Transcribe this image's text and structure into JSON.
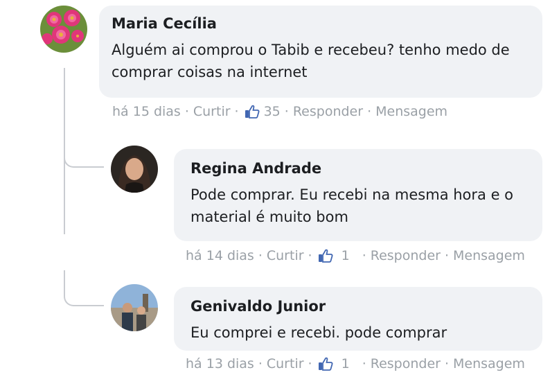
{
  "comments": [
    {
      "author": "Maria Cecília",
      "text": "Alguém ai comprou o Tabib e recebeu? tenho medo de comprar coisas na internet",
      "time": "há 15 dias",
      "like_label": "Curtir",
      "likes": "35",
      "reply_label": "Responder",
      "message_label": "Mensagem"
    },
    {
      "author": "Regina Andrade",
      "text": "Pode comprar. Eu recebi na mesma hora e o material é muito bom",
      "time": "há 14 dias",
      "like_label": "Curtir",
      "likes": "1",
      "reply_label": "Responder",
      "message_label": "Mensagem"
    },
    {
      "author": "Genivaldo Junior",
      "text": "Eu comprei e recebi. pode comprar",
      "time": "há 13 dias",
      "like_label": "Curtir",
      "likes": "1",
      "reply_label": "Responder",
      "message_label": "Mensagem"
    }
  ],
  "separator": "·",
  "icons": {
    "like": "thumbs-up-icon"
  },
  "colors": {
    "bubble": "#f0f2f5",
    "meta_text": "#9aa0a6",
    "like_blue": "#4267b2",
    "thread_line": "#c9ccd1"
  }
}
